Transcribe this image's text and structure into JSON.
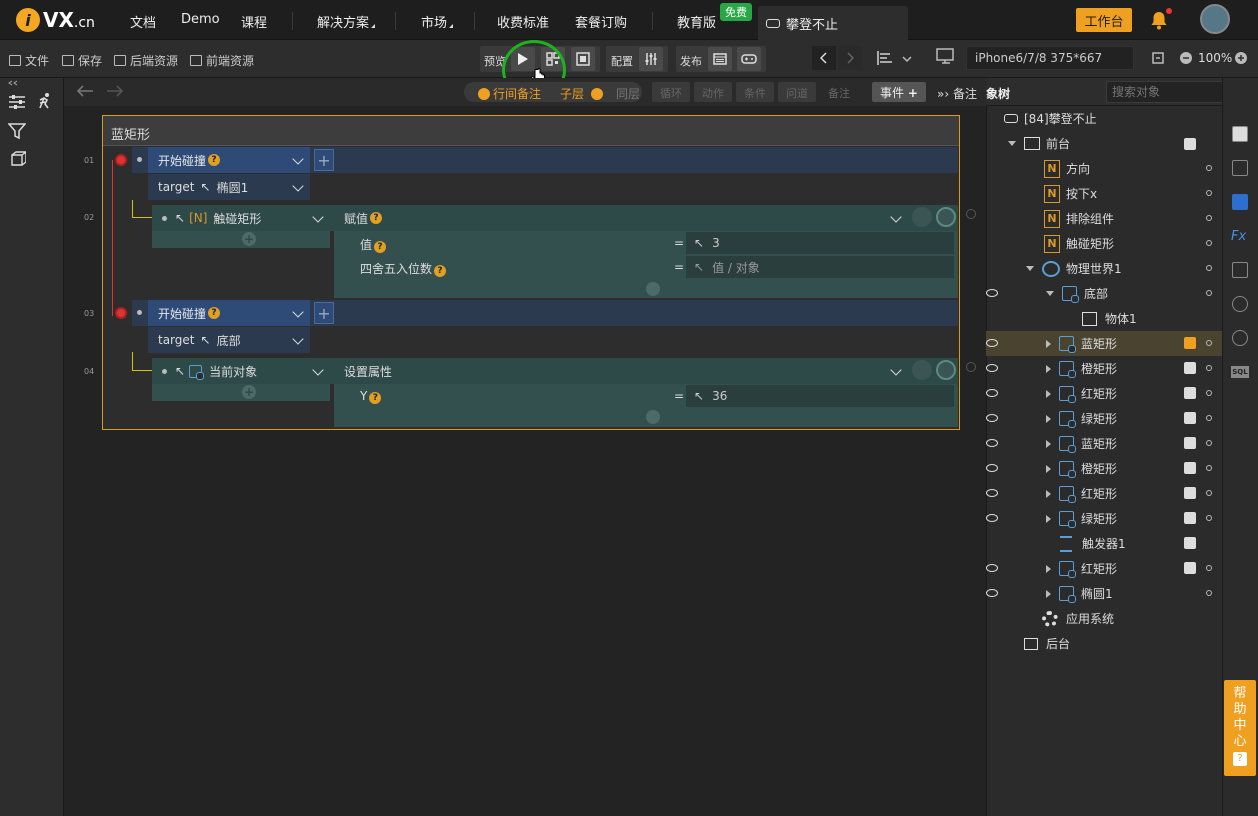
{
  "nav": {
    "logo_text": "VX",
    "logo_suffix": ".cn",
    "items": [
      {
        "label": "文档",
        "has_arrow": false
      },
      {
        "label": "Demo",
        "has_arrow": false
      },
      {
        "label": "课程",
        "has_arrow": false
      },
      {
        "label": "解决方案",
        "has_arrow": true
      },
      {
        "label": "市场",
        "has_arrow": true
      },
      {
        "label": "收费标准",
        "has_arrow": false
      },
      {
        "label": "套餐订购",
        "has_arrow": false
      },
      {
        "label": "教育版",
        "has_arrow": false
      }
    ],
    "free_badge": "免费",
    "active_tab": "攀登不止",
    "workspace_button": "工作台"
  },
  "toolbar": {
    "file": "文件",
    "save": "保存",
    "backend_resources": "后端资源",
    "frontend_resources": "前端资源",
    "preview": "预览",
    "config": "配置",
    "publish": "发布",
    "device": "iPhone6/7/8 375*667",
    "zoom": "100%"
  },
  "subbar": {
    "row_comment": "行间备注",
    "child_layer": "子层",
    "same_layer": "同层",
    "chips": [
      "循环",
      "动作",
      "条件",
      "问道",
      "备注"
    ],
    "event_button": "事件",
    "comments": "备注"
  },
  "editor": {
    "block_title": "蓝矩形",
    "line_numbers": [
      "01",
      "02",
      "03",
      "04"
    ],
    "events": [
      {
        "trigger": "开始碰撞",
        "target_label": "target",
        "target_value": "椭圆1",
        "action_target": "触碰矩形",
        "action": "赋值",
        "params": [
          {
            "label": "值",
            "value": "3"
          },
          {
            "label": "四舍五入位数",
            "value": "值 / 对象"
          }
        ]
      },
      {
        "trigger": "开始碰撞",
        "target_label": "target",
        "target_value": "底部",
        "action_target": "当前对象",
        "action": "设置属性",
        "params": [
          {
            "label": "Y",
            "value": "36"
          }
        ]
      }
    ]
  },
  "tree": {
    "header_tab": "象树",
    "search_placeholder": "搜索对象",
    "root": "[84]攀登不止",
    "foreground": "前台",
    "nodes": [
      {
        "label": "方向",
        "type": "n"
      },
      {
        "label": "按下x",
        "type": "n"
      },
      {
        "label": "排除组件",
        "type": "n"
      },
      {
        "label": "触碰矩形",
        "type": "n"
      },
      {
        "label": "物理世界1",
        "type": "physics"
      },
      {
        "label": "底部",
        "type": "shape"
      },
      {
        "label": "物体1",
        "type": "body"
      },
      {
        "label": "蓝矩形",
        "type": "shape",
        "highlight": true
      },
      {
        "label": "橙矩形",
        "type": "shape"
      },
      {
        "label": "红矩形",
        "type": "shape"
      },
      {
        "label": "绿矩形",
        "type": "shape"
      },
      {
        "label": "蓝矩形",
        "type": "shape"
      },
      {
        "label": "橙矩形",
        "type": "shape"
      },
      {
        "label": "红矩形",
        "type": "shape"
      },
      {
        "label": "绿矩形",
        "type": "shape"
      },
      {
        "label": "触发器1",
        "type": "trigger"
      },
      {
        "label": "红矩形",
        "type": "shape"
      },
      {
        "label": "椭圆1",
        "type": "shape"
      }
    ],
    "app_system": "应用系统",
    "background": "后台"
  },
  "help": "帮助中心",
  "colors": {
    "accent": "#f0a020",
    "event_blue": "#2e4b78",
    "action_teal": "#2e4a48",
    "highlight": "#4a4330"
  }
}
